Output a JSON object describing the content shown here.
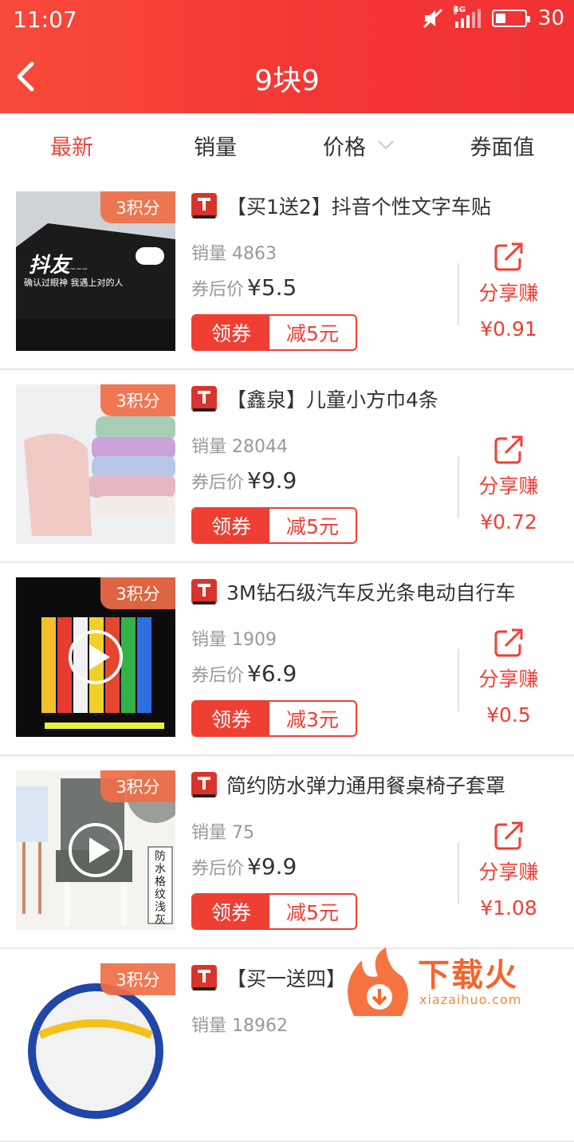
{
  "status_bar": {
    "time": "11:07",
    "network": "4G",
    "battery": "30"
  },
  "header": {
    "title": "9块9",
    "back_icon": "chevron-left-icon"
  },
  "sort_tabs": [
    {
      "label": "最新",
      "active": true
    },
    {
      "label": "销量",
      "active": false
    },
    {
      "label": "价格",
      "active": false,
      "has_dropdown": true
    },
    {
      "label": "券面值",
      "active": false
    }
  ],
  "products": [
    {
      "badge": "3积分",
      "title": "【买1送2】抖音个性文字车贴",
      "sales_label": "销量",
      "sales": "4863",
      "price_label": "券后价",
      "price": "¥5.5",
      "coupon_btn": "领券",
      "coupon_value": "减5元",
      "share_label": "分享赚",
      "commission": "¥0.91",
      "thumb_text": "抖友",
      "thumb_sub": "确认过眼神 我遇上对的人"
    },
    {
      "badge": "3积分",
      "title": "【鑫泉】儿童小方巾4条",
      "sales_label": "销量",
      "sales": "28044",
      "price_label": "券后价",
      "price": "¥9.9",
      "coupon_btn": "领券",
      "coupon_value": "减5元",
      "share_label": "分享赚",
      "commission": "¥0.72"
    },
    {
      "badge": "3积分",
      "title": "3M钻石级汽车反光条电动自行车",
      "sales_label": "销量",
      "sales": "1909",
      "price_label": "券后价",
      "price": "¥6.9",
      "coupon_btn": "领券",
      "coupon_value": "减3元",
      "share_label": "分享赚",
      "commission": "¥0.5"
    },
    {
      "badge": "3积分",
      "title": "简约防水弹力通用餐桌椅子套罩",
      "sales_label": "销量",
      "sales": "75",
      "price_label": "券后价",
      "price": "¥9.9",
      "coupon_btn": "领券",
      "coupon_value": "减5元",
      "share_label": "分享赚",
      "commission": "¥1.08",
      "thumb_text": "防水格纹浅灰"
    },
    {
      "badge": "3积分",
      "title": "【买一送四】",
      "sales_label": "销量",
      "sales": "18962"
    }
  ],
  "watermark": {
    "text": "下载火",
    "sub": "xiazaihuo.com"
  },
  "colors": {
    "accent": "#ef3f33",
    "header": "#f43535"
  }
}
